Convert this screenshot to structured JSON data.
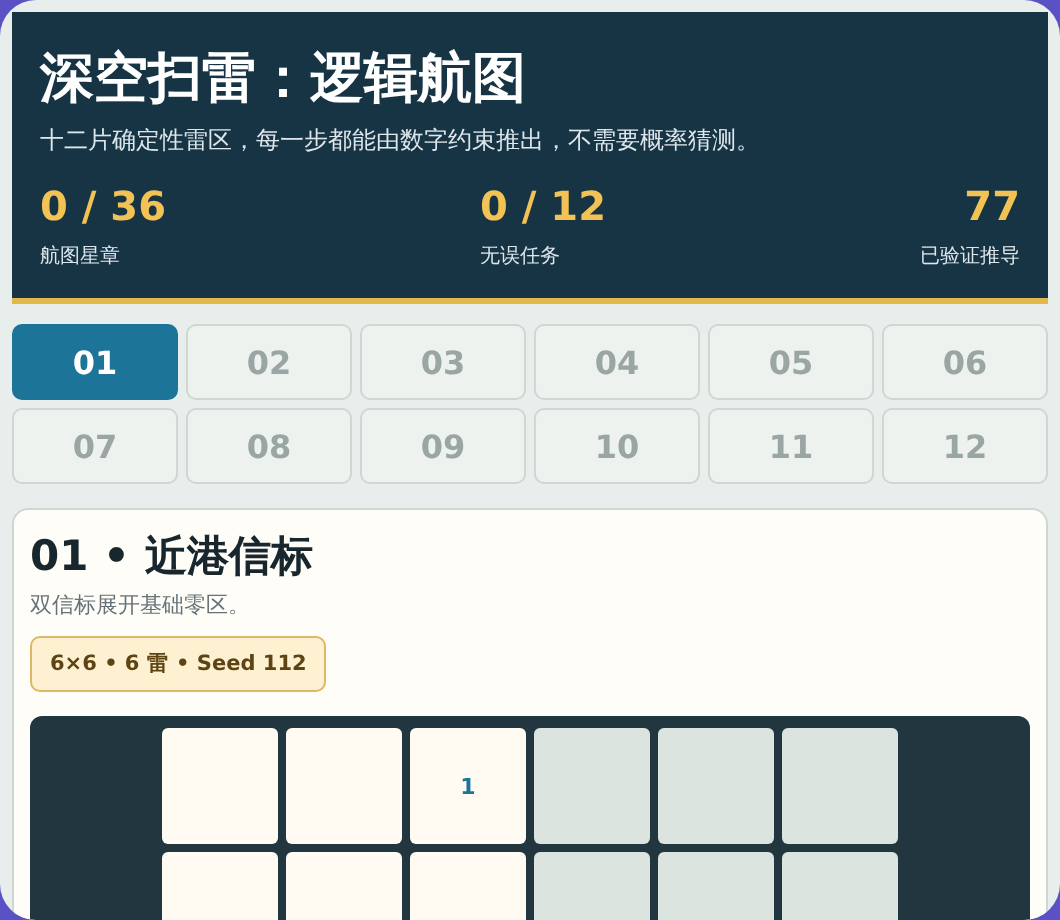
{
  "header": {
    "title": "深空扫雷：逻辑航图",
    "subtitle": "十二片确定性雷区，每一步都能由数字约束推出，不需要概率猜测。",
    "stats": [
      {
        "value": "0 / 36",
        "label": "航图星章"
      },
      {
        "value": "0 / 12",
        "label": "无误任务"
      },
      {
        "value": "77",
        "label": "已验证推导"
      }
    ]
  },
  "levels": [
    {
      "label": "01",
      "selected": true
    },
    {
      "label": "02",
      "selected": false
    },
    {
      "label": "03",
      "selected": false
    },
    {
      "label": "04",
      "selected": false
    },
    {
      "label": "05",
      "selected": false
    },
    {
      "label": "06",
      "selected": false
    },
    {
      "label": "07",
      "selected": false
    },
    {
      "label": "08",
      "selected": false
    },
    {
      "label": "09",
      "selected": false
    },
    {
      "label": "10",
      "selected": false
    },
    {
      "label": "11",
      "selected": false
    },
    {
      "label": "12",
      "selected": false
    }
  ],
  "mission": {
    "title": "01 • 近港信标",
    "description": "双信标展开基础零区。",
    "badge": "6×6 • 6 雷 • Seed 112",
    "board": [
      [
        {
          "revealed": true
        },
        {
          "revealed": true
        },
        {
          "revealed": true,
          "number": "1"
        },
        {
          "revealed": false
        },
        {
          "revealed": false
        },
        {
          "revealed": false
        }
      ],
      [
        {
          "revealed": true
        },
        {
          "revealed": true
        },
        {
          "revealed": true
        },
        {
          "revealed": false
        },
        {
          "revealed": false
        },
        {
          "revealed": false
        }
      ]
    ]
  }
}
